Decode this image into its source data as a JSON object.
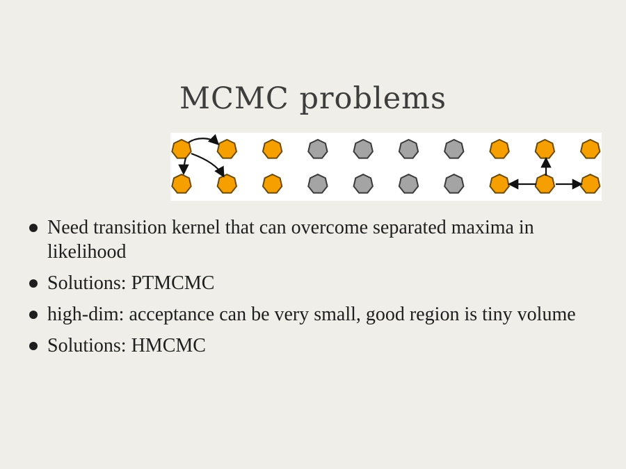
{
  "slide": {
    "title": "MCMC problems",
    "bullets": [
      "Need transition kernel that can overcome separated maxima in likelihood",
      "Solutions: PTMCMC",
      "high-dim: acceptance can be very small, good region is tiny volume",
      "Solutions: HMCMC"
    ]
  },
  "figure": {
    "colors": {
      "active": "#f5a000",
      "inactive": "#a4a4a4",
      "stroke": "#5a4a1a",
      "arrow": "#111111"
    },
    "node_states": [
      [
        "active",
        "active",
        "active",
        "inactive",
        "inactive",
        "inactive",
        "inactive",
        "active",
        "active",
        "active"
      ],
      [
        "active",
        "active",
        "active",
        "inactive",
        "inactive",
        "inactive",
        "inactive",
        "active",
        "active",
        "active"
      ]
    ]
  }
}
